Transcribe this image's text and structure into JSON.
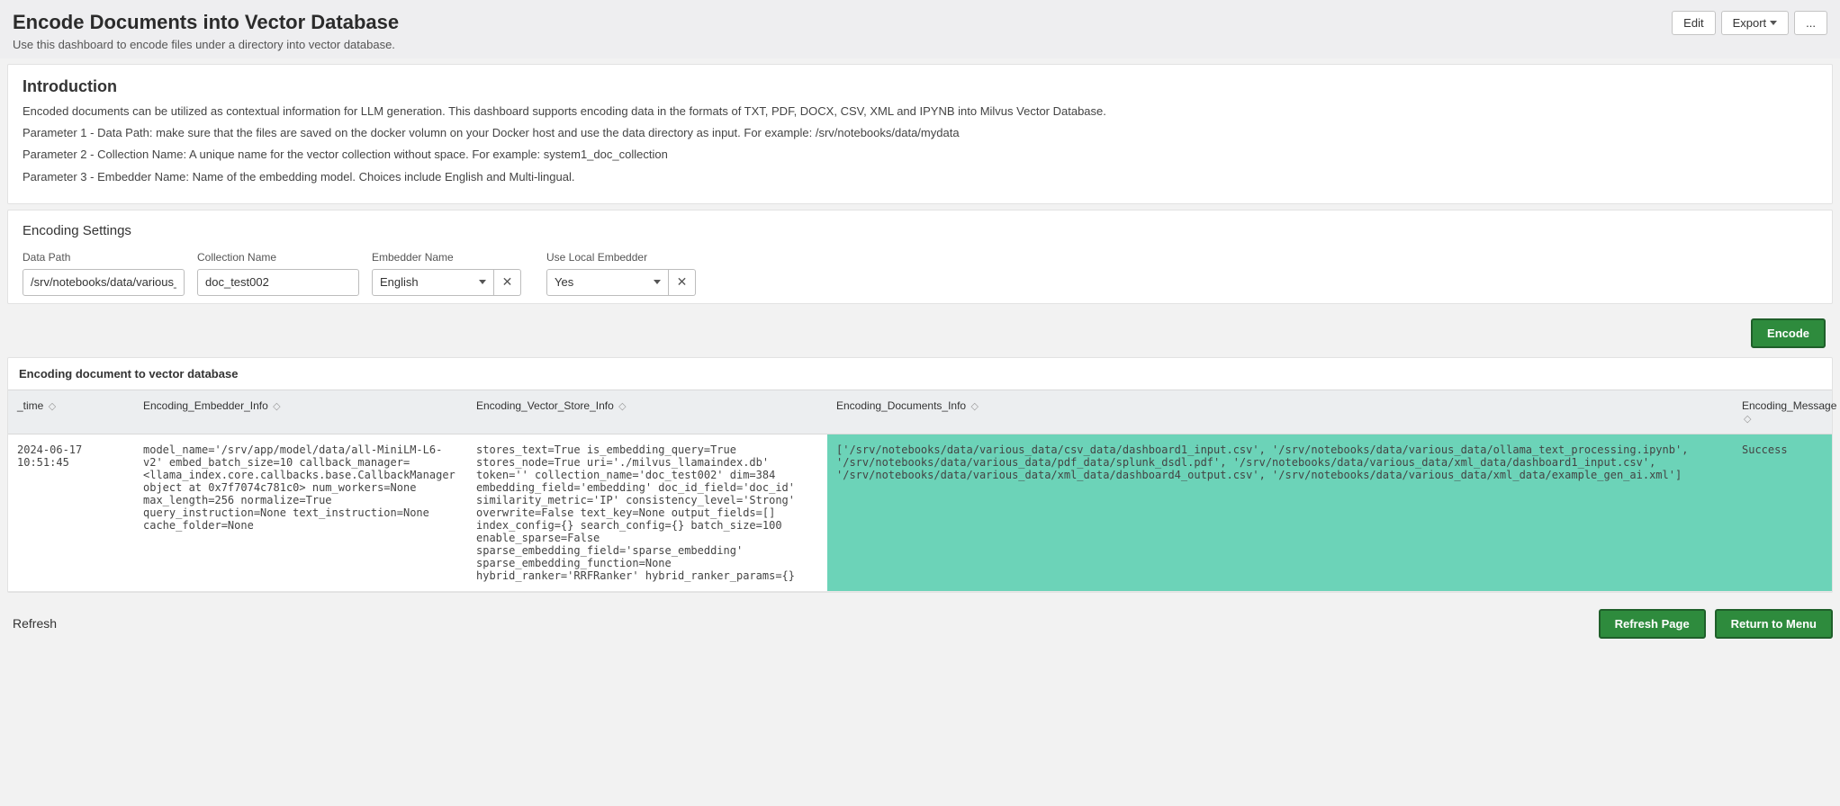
{
  "header": {
    "title": "Encode Documents into Vector Database",
    "subtitle": "Use this dashboard to encode files under a directory into vector database.",
    "edit_label": "Edit",
    "export_label": "Export",
    "more_label": "..."
  },
  "intro": {
    "heading": "Introduction",
    "desc": "Encoded documents can be utilized as contextual information for LLM generation. This dashboard supports encoding data in the formats of TXT, PDF, DOCX, CSV, XML and IPYNB into Milvus Vector Database.",
    "param1": "Parameter 1 - Data Path: make sure that the files are saved on the docker volumn on your Docker host and use the data directory as input. For example: /srv/notebooks/data/mydata",
    "param2": "Parameter 2 - Collection Name: A unique name for the vector collection without space. For example: system1_doc_collection",
    "param3": "Parameter 3 - Embedder Name: Name of the embedding model. Choices include English and Multi-lingual."
  },
  "settings": {
    "title": "Encoding Settings",
    "data_path": {
      "label": "Data Path",
      "value": "/srv/notebooks/data/various_dat"
    },
    "collection_name": {
      "label": "Collection Name",
      "value": "doc_test002"
    },
    "embedder_name": {
      "label": "Embedder Name",
      "value": "English"
    },
    "use_local": {
      "label": "Use Local Embedder",
      "value": "Yes"
    }
  },
  "encode_button": "Encode",
  "results": {
    "title": "Encoding document to vector database",
    "columns": {
      "time": "_time",
      "embedder": "Encoding_Embedder_Info",
      "vector": "Encoding_Vector_Store_Info",
      "documents": "Encoding_Documents_Info",
      "message": "Encoding_Message"
    },
    "row": {
      "time": "2024-06-17 10:51:45",
      "embedder": "model_name='/srv/app/model/data/all-MiniLM-L6-v2' embed_batch_size=10 callback_manager=<llama_index.core.callbacks.base.CallbackManager object at 0x7f7074c781c0> num_workers=None max_length=256 normalize=True query_instruction=None text_instruction=None cache_folder=None",
      "vector": "stores_text=True is_embedding_query=True stores_node=True uri='./milvus_llamaindex.db' token='' collection_name='doc_test002' dim=384 embedding_field='embedding' doc_id_field='doc_id' similarity_metric='IP' consistency_level='Strong' overwrite=False text_key=None output_fields=[] index_config={} search_config={} batch_size=100 enable_sparse=False sparse_embedding_field='sparse_embedding' sparse_embedding_function=None hybrid_ranker='RRFRanker' hybrid_ranker_params={}",
      "documents": "['/srv/notebooks/data/various_data/csv_data/dashboard1_input.csv', '/srv/notebooks/data/various_data/ollama_text_processing.ipynb', '/srv/notebooks/data/various_data/pdf_data/splunk_dsdl.pdf', '/srv/notebooks/data/various_data/xml_data/dashboard1_input.csv', '/srv/notebooks/data/various_data/xml_data/dashboard4_output.csv', '/srv/notebooks/data/various_data/xml_data/example_gen_ai.xml']",
      "message": "Success"
    }
  },
  "footer": {
    "refresh": "Refresh",
    "refresh_page": "Refresh Page",
    "return_menu": "Return to Menu"
  }
}
